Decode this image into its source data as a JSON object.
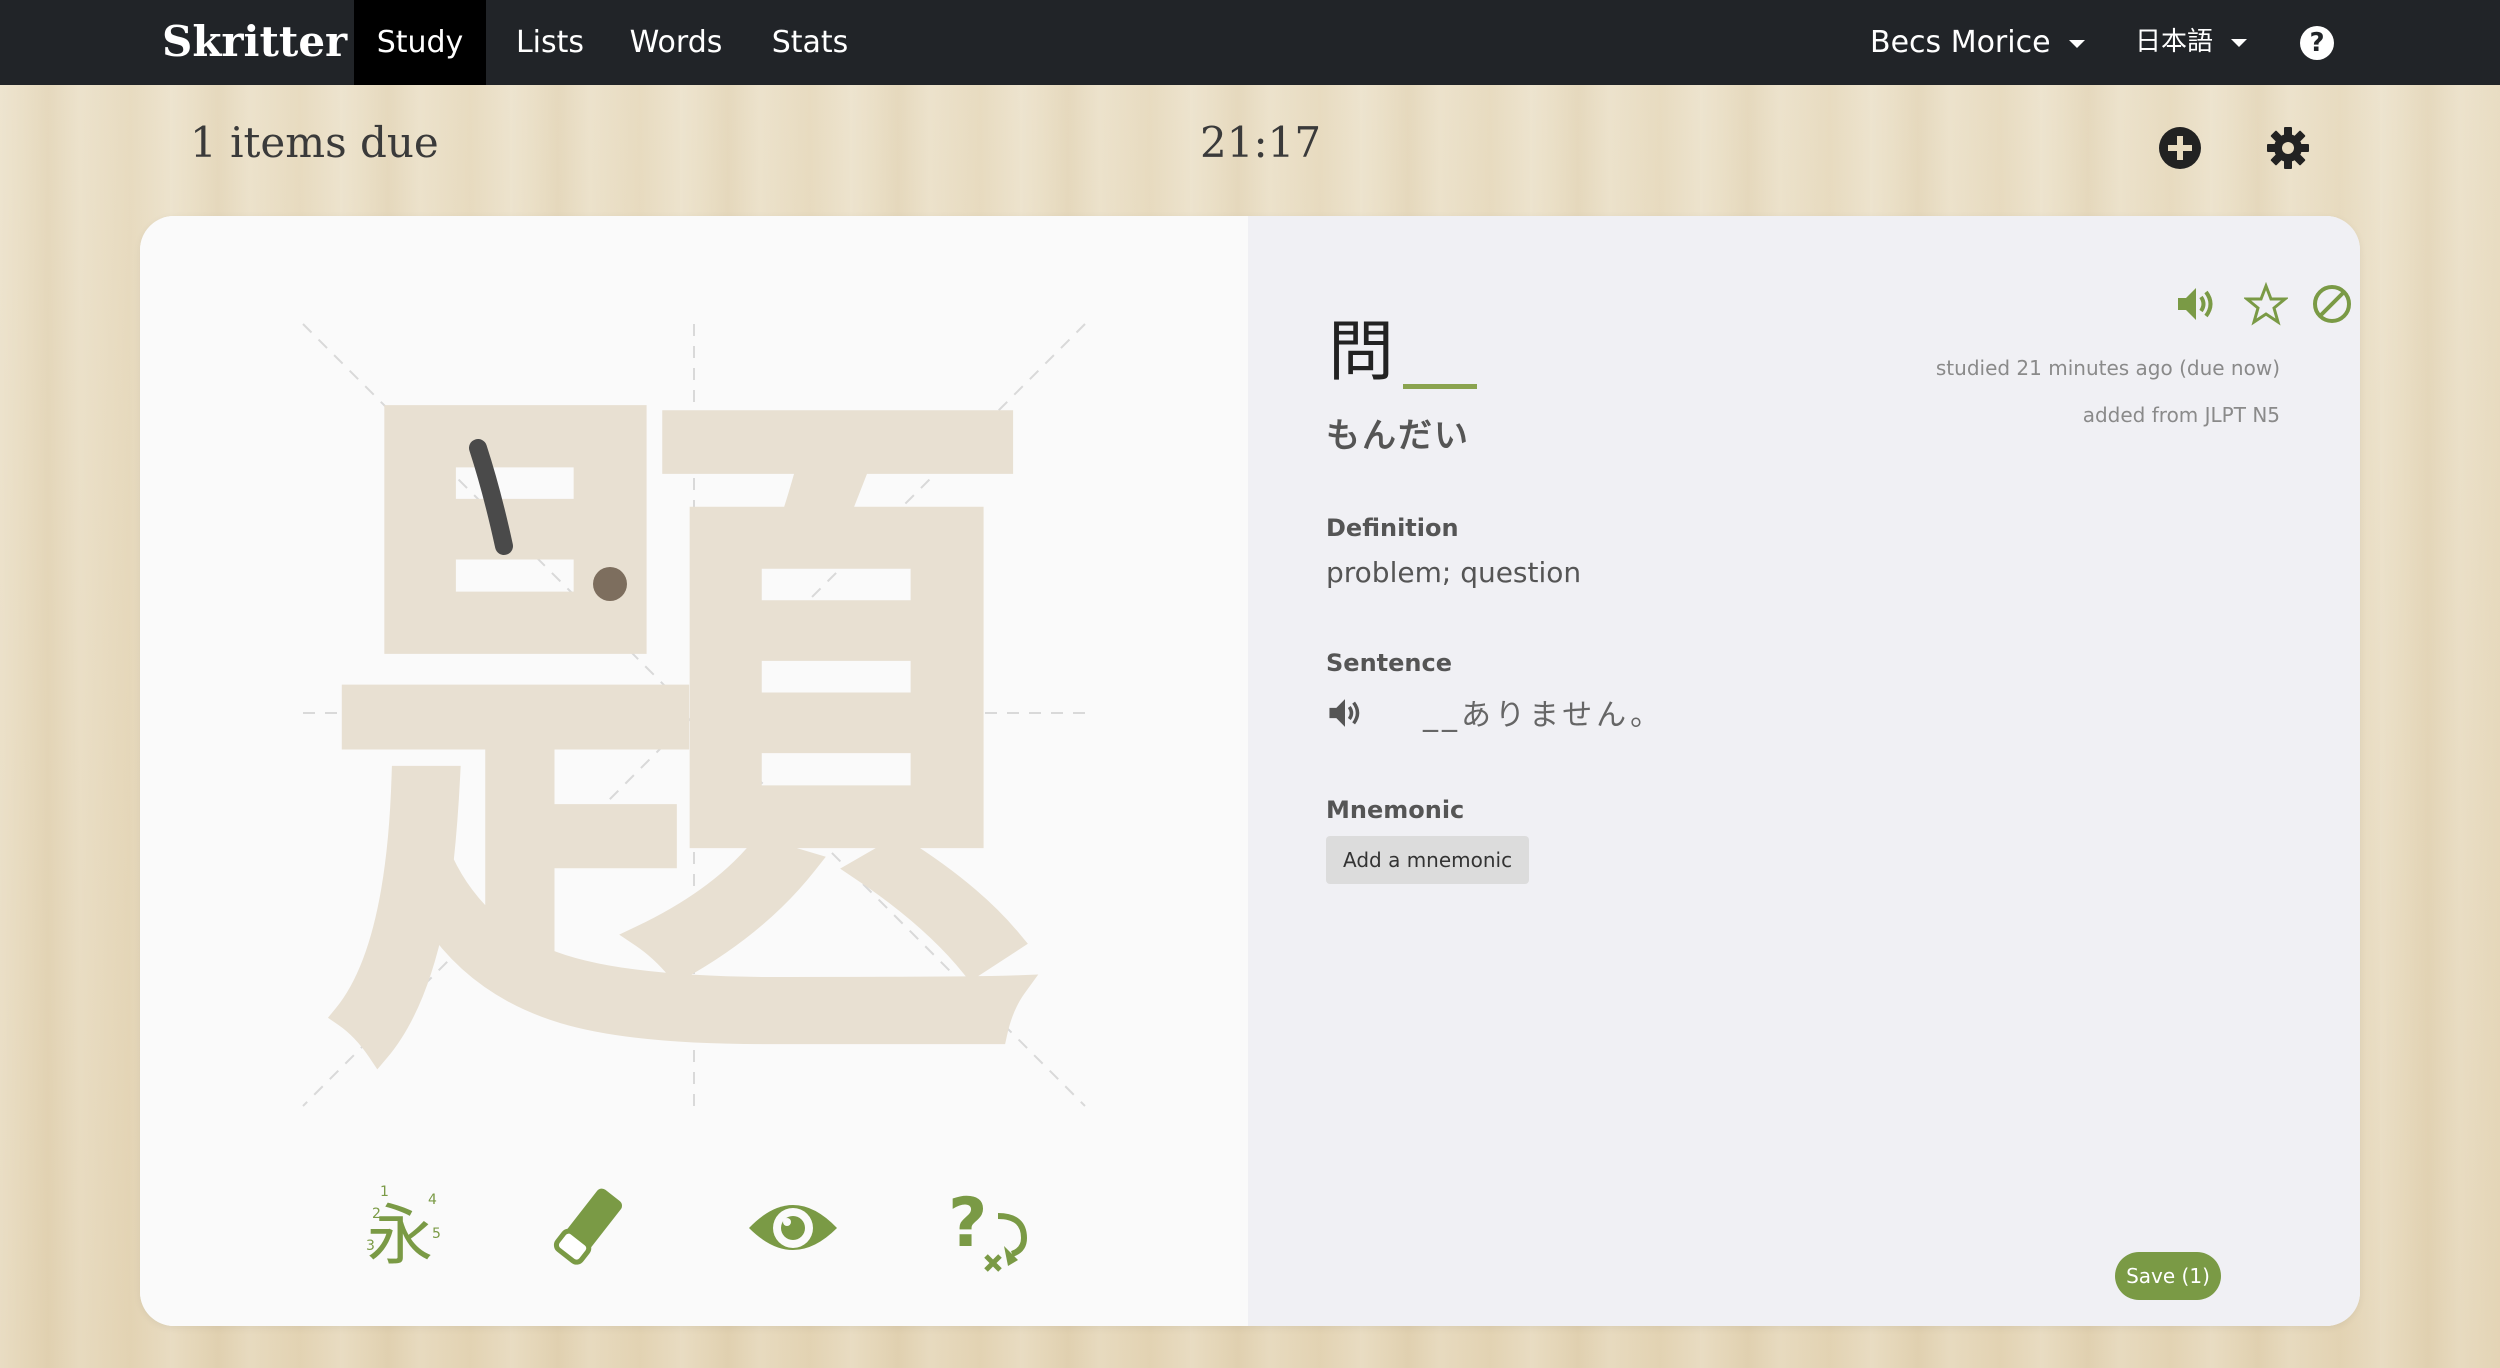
{
  "nav": {
    "brand": "Skritter",
    "items": [
      {
        "label": "Study",
        "active": true
      },
      {
        "label": "Lists",
        "active": false
      },
      {
        "label": "Words",
        "active": false
      },
      {
        "label": "Stats",
        "active": false
      }
    ],
    "user": "Becs Morice",
    "language": "日本語",
    "help_icon": "question-circle-icon"
  },
  "toolbar": {
    "items_due": "1 items due",
    "timer": "21:17",
    "add_icon": "plus-circle-icon",
    "settings_icon": "gear-icon"
  },
  "prompt": {
    "target_character": "題",
    "tools": [
      {
        "name": "stroke-order-icon",
        "label": "永"
      },
      {
        "name": "eraser-icon"
      },
      {
        "name": "eye-icon"
      },
      {
        "name": "question-reveal-icon"
      }
    ]
  },
  "details": {
    "word_first_char": "問",
    "reading": "もんだい",
    "actions": [
      "audio-icon",
      "star-icon",
      "ban-icon",
      "info-icon"
    ],
    "studied": "studied 21 minutes ago (due now)",
    "added_from": "added from JLPT N5",
    "definition_label": "Definition",
    "definition": "problem; question",
    "sentence_label": "Sentence",
    "sentence": "__ありません。",
    "mnemonic_label": "Mnemonic",
    "add_mnemonic": "Add a mnemonic",
    "save": "Save (1)"
  },
  "colors": {
    "accent": "#7a9a45",
    "navbar": "#212428",
    "ghost_character": "#e8e0d2",
    "user_stroke": "#4a4a4a"
  }
}
